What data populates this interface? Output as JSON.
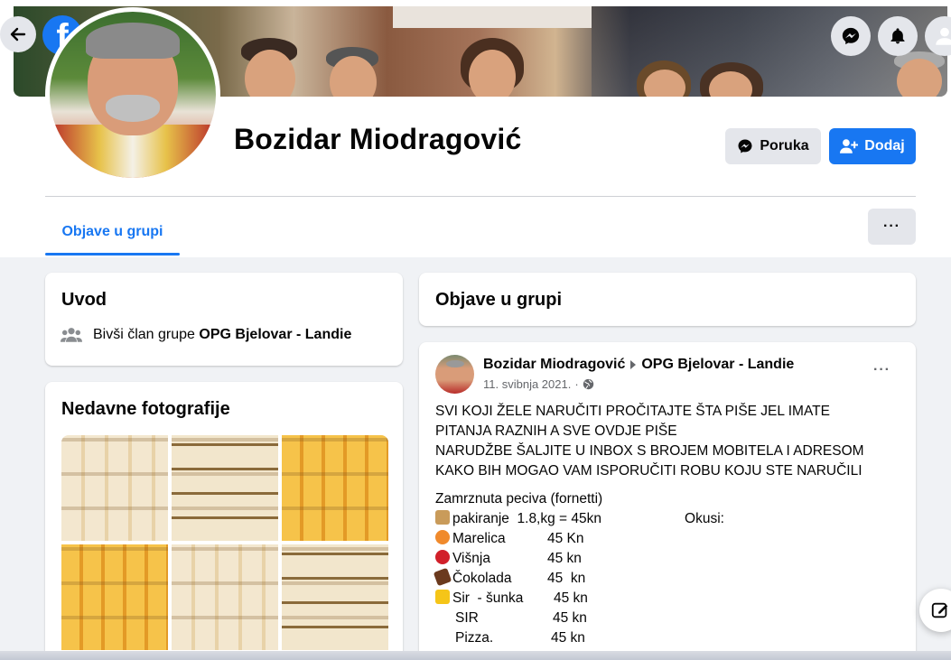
{
  "app": {
    "logo_letter": "f"
  },
  "header": {
    "back_icon": "arrow-left-icon",
    "icons": [
      "messenger-icon",
      "notifications-bell-icon",
      "account-icon"
    ]
  },
  "profile": {
    "name": "Bozidar Miodragović",
    "message_button": "Poruka",
    "add_friend_button": "Dodaj",
    "more_button": "···"
  },
  "tabs": [
    {
      "label": "Objave u grupi",
      "active": true
    }
  ],
  "intro": {
    "title": "Uvod",
    "former_member_prefix": "Bivši član grupe",
    "group_name": "OPG Bjelovar - Landie"
  },
  "photos": {
    "title": "Nedavne fotografije",
    "count": 6
  },
  "posts_section": {
    "title": "Objave u grupi"
  },
  "post": {
    "author": "Bozidar Miodragović",
    "group": "OPG Bjelovar - Landie",
    "date": "11. svibnja 2021.",
    "separator": "·",
    "options": "···",
    "lines": [
      "SVI KOJI ŽELE NARUČITI PROČITAJTE ŠTA PIŠE JEL IMATE",
      "PITANJA RAZNIH A SVE OVDJE PIŠE",
      "NARUDŽBE ŠALJITE U INBOX S BROJEM MOBITELA I ADRESOM",
      "KAKO BIH MOGAO VAM ISPORUČITI ROBU KOJU STE NARUČILI"
    ],
    "menu_title": "Zamrznuta peciva (fornetti)",
    "packaging": "pakiranje  1.8,kg = 45kn",
    "flavours_label": "Okusi:",
    "items": [
      {
        "name": "Marelica",
        "price": "45 Kn",
        "emoji_color": "#f08a2c"
      },
      {
        "name": "Višnja",
        "price": "45 kn",
        "emoji_color": "#d1202a"
      },
      {
        "name": "Čokolada",
        "price": "45  kn",
        "emoji_color": "#6b3a1e"
      },
      {
        "name": "Sir  - šunka",
        "price": "45 kn",
        "emoji_color": "#f5c518"
      },
      {
        "name": "SIR",
        "price": "45 kn",
        "emoji_color": ""
      },
      {
        "name": "Pizza.",
        "price": "45 kn",
        "emoji_color": ""
      }
    ]
  },
  "colors": {
    "accent": "#1877f2",
    "background": "#f0f2f5",
    "secondary_button": "#e4e6eb",
    "muted_text": "#65676b"
  }
}
